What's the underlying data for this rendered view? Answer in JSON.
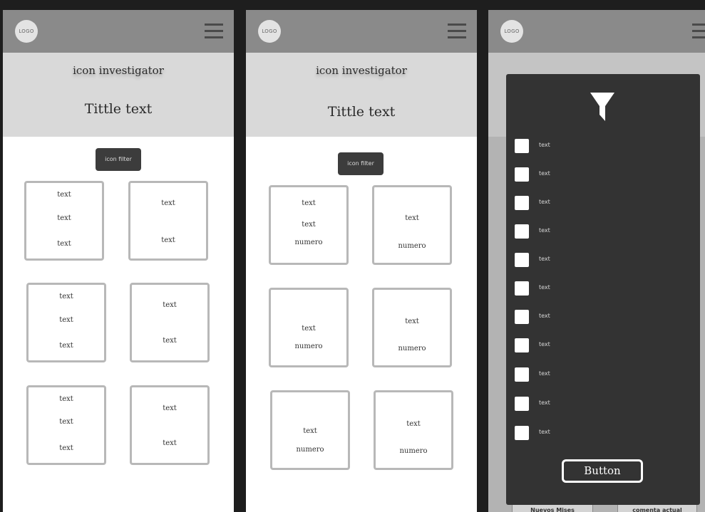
{
  "logo_text": "LOGO",
  "hero": {
    "subtitle": "icon investigator",
    "title": "Tittle text"
  },
  "filter_button_label": "icon filter",
  "panel1": {
    "cards": [
      {
        "lines": [
          "text",
          "text",
          "text"
        ]
      },
      {
        "lines": [
          "text",
          "text"
        ]
      },
      {
        "lines": [
          "text",
          "text",
          "text"
        ]
      },
      {
        "lines": [
          "text",
          "text"
        ]
      },
      {
        "lines": [
          "text",
          "text",
          "text"
        ]
      },
      {
        "lines": [
          "text",
          "text"
        ]
      }
    ]
  },
  "panel2": {
    "cards": [
      {
        "lines": [
          "text",
          "text",
          "numero"
        ]
      },
      {
        "lines": [
          "text",
          "numero"
        ]
      },
      {
        "lines": [
          "text",
          "numero"
        ]
      },
      {
        "lines": [
          "text",
          "numero"
        ]
      },
      {
        "lines": [
          "text",
          "numero"
        ]
      },
      {
        "lines": [
          "text",
          "numero"
        ]
      }
    ]
  },
  "filter_overlay": {
    "icon": "filter-funnel-icon",
    "options": [
      "text",
      "text",
      "text",
      "text",
      "text",
      "text",
      "text",
      "text",
      "text",
      "text",
      "text"
    ],
    "button_label": "Button"
  },
  "bottom_buttons": [
    "Nuevos Mises",
    "comenta actual"
  ],
  "colors": {
    "header": "#8a8a8a",
    "hero": "#d9d9d9",
    "overlay": "#333333",
    "card_border": "#b8b8b8"
  }
}
